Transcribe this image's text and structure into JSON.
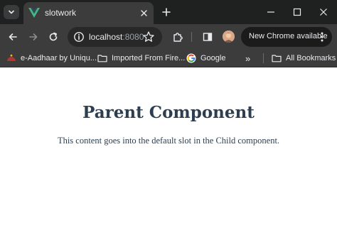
{
  "browser": {
    "tab": {
      "title": "slotwork",
      "favicon": "vue-logo-icon"
    },
    "address_bar": {
      "host": "localhost",
      "port": ":8080"
    },
    "update_button": {
      "label": "New Chrome available"
    },
    "bookmarks": [
      {
        "label": "e-Aadhaar by Uniqu...",
        "icon": "aadhaar-logo-icon"
      },
      {
        "label": "Imported From Fire...",
        "icon": "folder-icon"
      },
      {
        "label": "Google",
        "icon": "google-logo-icon"
      },
      {
        "label": "All Bookmarks",
        "icon": "folder-icon"
      }
    ],
    "overflow_label": "»",
    "colors": {
      "tab_strip": "#1f2020",
      "toolbar": "#3c3c3c",
      "omnibox": "#282828",
      "vue_green": "#41b883",
      "text_light": "#e8eaed"
    }
  },
  "page": {
    "title": "Parent Component",
    "content": "This content goes into the default slot in the Child component.",
    "text_color": "#2c3e50"
  }
}
